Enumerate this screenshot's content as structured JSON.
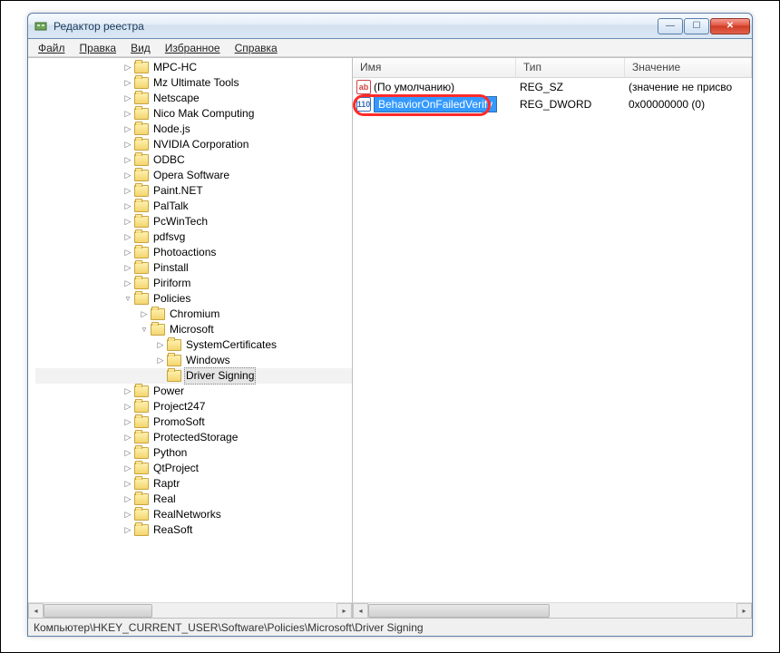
{
  "window": {
    "title": "Редактор реестра"
  },
  "menu": {
    "file": "Файл",
    "edit": "Правка",
    "view": "Вид",
    "favorites": "Избранное",
    "help": "Справка"
  },
  "tree": {
    "nodes": [
      {
        "indent": 96,
        "exp": "▷",
        "label": "MPC-HC"
      },
      {
        "indent": 96,
        "exp": "▷",
        "label": "Mz Ultimate Tools"
      },
      {
        "indent": 96,
        "exp": "▷",
        "label": "Netscape"
      },
      {
        "indent": 96,
        "exp": "▷",
        "label": "Nico Mak Computing"
      },
      {
        "indent": 96,
        "exp": "▷",
        "label": "Node.js"
      },
      {
        "indent": 96,
        "exp": "▷",
        "label": "NVIDIA Corporation"
      },
      {
        "indent": 96,
        "exp": "▷",
        "label": "ODBC"
      },
      {
        "indent": 96,
        "exp": "▷",
        "label": "Opera Software"
      },
      {
        "indent": 96,
        "exp": "▷",
        "label": "Paint.NET"
      },
      {
        "indent": 96,
        "exp": "▷",
        "label": "PalTalk"
      },
      {
        "indent": 96,
        "exp": "▷",
        "label": "PcWinTech"
      },
      {
        "indent": 96,
        "exp": "▷",
        "label": "pdfsvg"
      },
      {
        "indent": 96,
        "exp": "▷",
        "label": "Photoactions"
      },
      {
        "indent": 96,
        "exp": "▷",
        "label": "Pinstall"
      },
      {
        "indent": 96,
        "exp": "▷",
        "label": "Piriform"
      },
      {
        "indent": 96,
        "exp": "▿",
        "label": "Policies"
      },
      {
        "indent": 114,
        "exp": "▷",
        "label": "Chromium"
      },
      {
        "indent": 114,
        "exp": "▿",
        "label": "Microsoft"
      },
      {
        "indent": 132,
        "exp": "▷",
        "label": "SystemCertificates"
      },
      {
        "indent": 132,
        "exp": "▷",
        "label": "Windows"
      },
      {
        "indent": 132,
        "exp": "",
        "label": "Driver Signing",
        "selected": true
      },
      {
        "indent": 96,
        "exp": "▷",
        "label": "Power"
      },
      {
        "indent": 96,
        "exp": "▷",
        "label": "Project247"
      },
      {
        "indent": 96,
        "exp": "▷",
        "label": "PromoSoft"
      },
      {
        "indent": 96,
        "exp": "▷",
        "label": "ProtectedStorage"
      },
      {
        "indent": 96,
        "exp": "▷",
        "label": "Python"
      },
      {
        "indent": 96,
        "exp": "▷",
        "label": "QtProject"
      },
      {
        "indent": 96,
        "exp": "▷",
        "label": "Raptr"
      },
      {
        "indent": 96,
        "exp": "▷",
        "label": "Real"
      },
      {
        "indent": 96,
        "exp": "▷",
        "label": "RealNetworks"
      },
      {
        "indent": 96,
        "exp": "▷",
        "label": "ReaSoft"
      }
    ]
  },
  "columns": {
    "name": "Имя",
    "type": "Тип",
    "value": "Значение"
  },
  "values": [
    {
      "icon": "sz",
      "name": "(По умолчанию)",
      "type": "REG_SZ",
      "value": "(значение не присво"
    },
    {
      "icon": "dw",
      "name": "BehaviorOnFailedVerify",
      "type": "REG_DWORD",
      "value": "0x00000000 (0)",
      "editing": true
    }
  ],
  "statusbar": {
    "path": "Компьютер\\HKEY_CURRENT_USER\\Software\\Policies\\Microsoft\\Driver Signing"
  }
}
